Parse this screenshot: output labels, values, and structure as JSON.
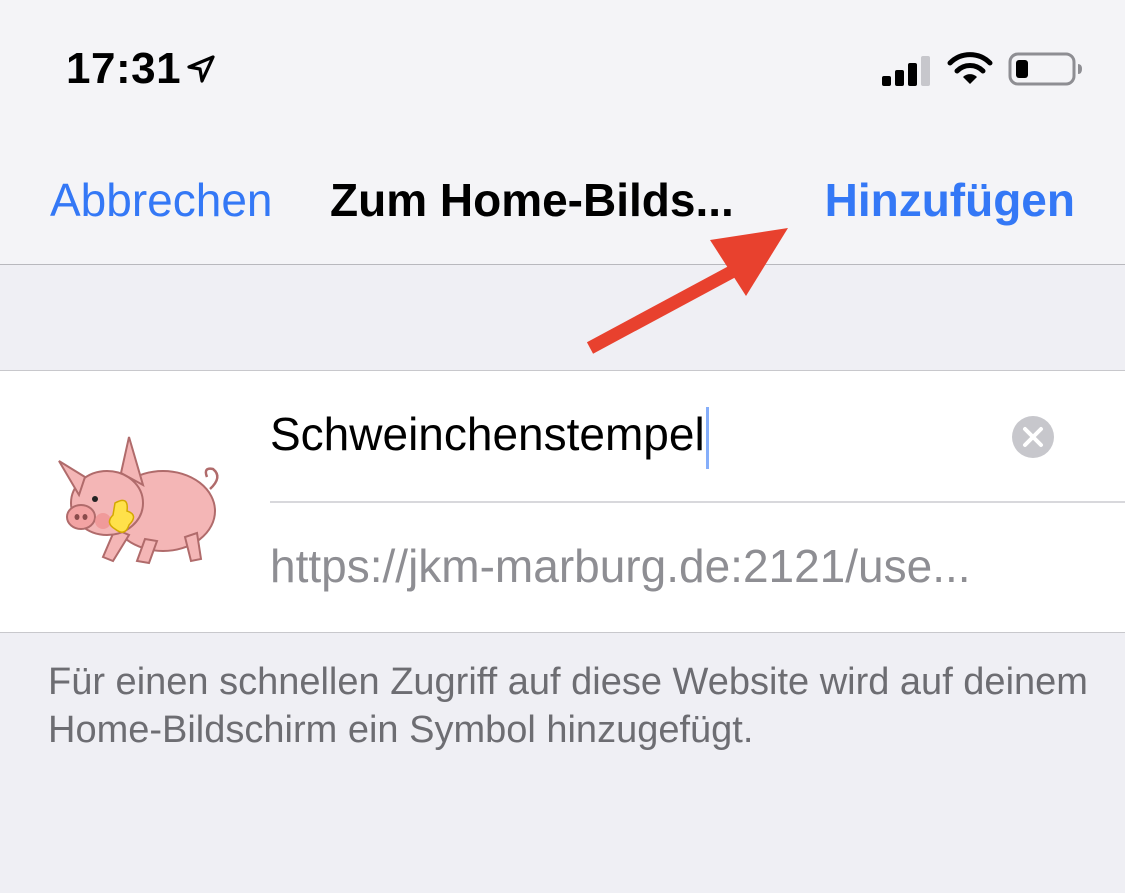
{
  "status_bar": {
    "time": "17:31",
    "icons": [
      "location-arrow-icon",
      "cellular-signal-icon",
      "wifi-icon",
      "battery-icon"
    ]
  },
  "nav": {
    "cancel_label": "Abbrechen",
    "title": "Zum Home-Bilds...",
    "add_label": "Hinzufügen"
  },
  "form": {
    "name_value": "Schweinchenstempel",
    "url_value": "https://jkm-marburg.de:2121/use...",
    "icon": "pig-app-icon"
  },
  "footer": {
    "note": "Für einen schnellen Zugriff auf diese Website wird auf deinem Home-Bildschirm ein Symbol hinzugefügt."
  },
  "colors": {
    "accent": "#3478f6",
    "background": "#efeff4",
    "annotation_arrow": "#e8412e"
  }
}
